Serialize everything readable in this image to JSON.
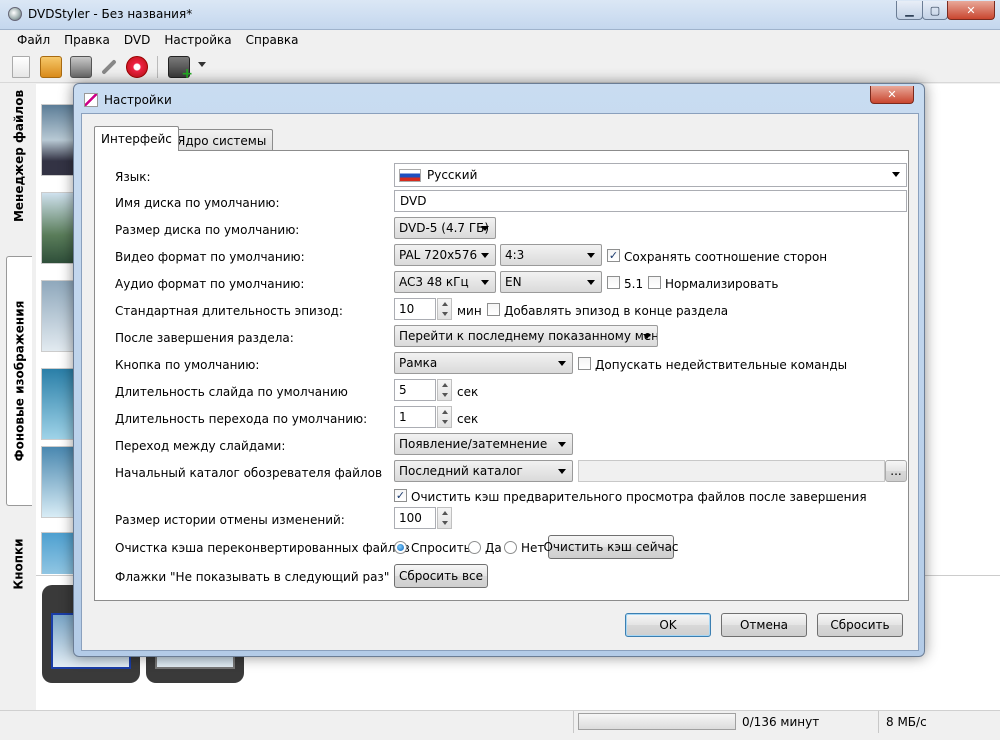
{
  "window": {
    "title": "DVDStyler - Без названия*"
  },
  "menubar": {
    "items": [
      "Файл",
      "Правка",
      "DVD",
      "Настройка",
      "Справка"
    ]
  },
  "toolbar": {
    "icons": [
      "new-file-icon",
      "open-folder-icon",
      "save-icon",
      "settings-wrench-icon",
      "burn-disc-icon",
      "add-file-icon",
      "dropdown-arrow-icon"
    ]
  },
  "sidebar": {
    "tabs": [
      "Менеджер файлов",
      "Фоновые изображения",
      "Кнопки"
    ]
  },
  "statusbar": {
    "minutes": "0/136 минут",
    "speed": "8 МБ/с",
    "progress": 0
  },
  "dialog": {
    "title": "Настройки",
    "tabs": [
      "Интерфейс",
      "Ядро системы"
    ],
    "active_tab": "Интерфейс",
    "rows": {
      "language": {
        "label": "Язык:",
        "value": "Русский"
      },
      "disc_name": {
        "label": "Имя диска по умолчанию:",
        "value": "DVD"
      },
      "disc_size": {
        "label": "Размер диска по умолчанию:",
        "value": "DVD-5 (4.7 ГБ)"
      },
      "video_format": {
        "label": "Видео формат по умолчанию:",
        "value": "PAL 720x576",
        "aspect": "4:3",
        "keep_aspect_label": "Сохранять соотношение сторон",
        "keep_aspect_checked": true
      },
      "audio_format": {
        "label": "Аудио формат по умолчанию:",
        "value": "AC3 48 кГц",
        "lang": "EN",
        "surround_label": "5.1",
        "surround_checked": false,
        "normalize_label": "Нормализировать",
        "normalize_checked": false
      },
      "episode_length": {
        "label": "Стандартная длительность эпизод:",
        "value": "10",
        "unit": "мин",
        "add_episode_label": "Добавлять эпизод в конце раздела",
        "add_episode_checked": false
      },
      "after_chapter": {
        "label": "После завершения раздела:",
        "value": "Перейти к последнему показанному меню"
      },
      "default_button": {
        "label": "Кнопка по умолчанию:",
        "value": "Рамка",
        "invalid_cmds_label": "Допускать недействительные команды",
        "invalid_cmds_checked": false
      },
      "slide_duration": {
        "label": "Длительность слайда по умолчанию",
        "value": "5",
        "unit": "сек"
      },
      "transition_duration": {
        "label": "Длительность перехода по умолчанию:",
        "value": "1",
        "unit": "сек"
      },
      "slide_transition": {
        "label": "Переход между слайдами:",
        "value": "Появление/затемнение"
      },
      "browser_dir": {
        "label": "Начальный каталог обозревателя файлов",
        "value": "Последний каталог",
        "path": "",
        "browse_label": "..."
      },
      "clear_preview_cache": {
        "label": "Очистить кэш предварительного просмотра файлов после завершения",
        "checked": true
      },
      "undo_history": {
        "label": "Размер истории отмены изменений:",
        "value": "100"
      },
      "cache_cleanup": {
        "label": "Очистка кэша переконвертированных файлов",
        "options": [
          "Спросить",
          "Да",
          "Нет"
        ],
        "selected": "Спросить",
        "clear_now_label": "Очистить кэш сейчас"
      },
      "flags": {
        "label": "Флажки \"Не показывать в следующий раз\"",
        "reset_all_label": "Сбросить все"
      }
    },
    "buttons": {
      "ok": "OK",
      "cancel": "Отмена",
      "reset": "Сбросить"
    }
  }
}
